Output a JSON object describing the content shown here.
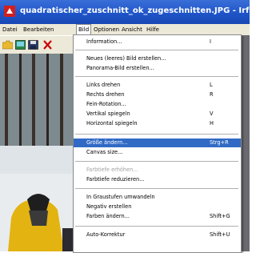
{
  "window": {
    "title": "quadratischer_zuschnitt_ok_zugeschnitten.JPG - IrfanV"
  },
  "menubar": {
    "items": [
      {
        "label": "Datei"
      },
      {
        "label": "Bearbeiten"
      },
      {
        "label": "Bild"
      },
      {
        "label": "Optionen"
      },
      {
        "label": "Ansicht"
      },
      {
        "label": "Hilfe"
      }
    ],
    "active": "Bild"
  },
  "toolbar": {
    "icons": [
      "open-folder-icon",
      "thumbnails-icon",
      "save-icon",
      "delete-icon"
    ],
    "delete_color": "#cc0000"
  },
  "dropdown": {
    "highlight_color": "#316ac5",
    "items": [
      {
        "label": "Information...",
        "shortcut": "I",
        "disabled": false
      },
      {
        "label": "Neues (leeres) Bild erstellen...",
        "shortcut": "",
        "disabled": false
      },
      {
        "label": "Panorama-Bild erstellen...",
        "shortcut": "",
        "disabled": false
      },
      {
        "label": "Links drehen",
        "shortcut": "L",
        "disabled": false
      },
      {
        "label": "Rechts drehen",
        "shortcut": "R",
        "disabled": false
      },
      {
        "label": "Fein-Rotation...",
        "shortcut": "",
        "disabled": false
      },
      {
        "label": "Vertikal spiegeln",
        "shortcut": "V",
        "disabled": false
      },
      {
        "label": "Horizontal spiegeln",
        "shortcut": "H",
        "disabled": false
      },
      {
        "label": "Größe ändern...",
        "shortcut": "Strg+R",
        "disabled": false,
        "highlighted": true
      },
      {
        "label": "Canvas size...",
        "shortcut": "",
        "disabled": false
      },
      {
        "label": "Farbtiefe erhöhen...",
        "shortcut": "",
        "disabled": true
      },
      {
        "label": "Farbtiefe reduzieren...",
        "shortcut": "",
        "disabled": false
      },
      {
        "label": "In Graustufen umwandeln",
        "shortcut": "",
        "disabled": false
      },
      {
        "label": "Negativ erstellen",
        "shortcut": "",
        "disabled": false
      },
      {
        "label": "Farben ändern...",
        "shortcut": "Shift+G",
        "disabled": false
      },
      {
        "label": "Auto-Korrektur",
        "shortcut": "Shift+U",
        "disabled": false
      }
    ]
  }
}
